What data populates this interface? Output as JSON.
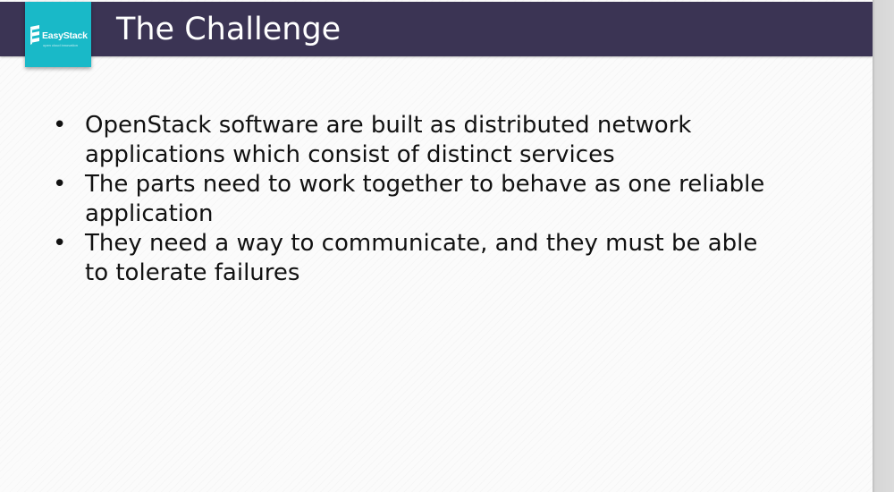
{
  "slide": {
    "title": "The Challenge",
    "logo": {
      "name": "EasyStack",
      "tagline": "open cloud innovation",
      "icon": "stacked-layers-logo-icon",
      "tile_color": "#19b9c8"
    },
    "title_bar_color": "#3b3454",
    "bullet_glyph": "•",
    "bullets": [
      {
        "lines": [
          "OpenStack software are built as distributed network",
          "applications which consist of distinct services"
        ]
      },
      {
        "lines": [
          "The parts need to work together to behave as one reliable",
          "application"
        ]
      },
      {
        "lines": [
          "They need a way to communicate, and they must be able",
          "to tolerate failures"
        ]
      }
    ]
  }
}
